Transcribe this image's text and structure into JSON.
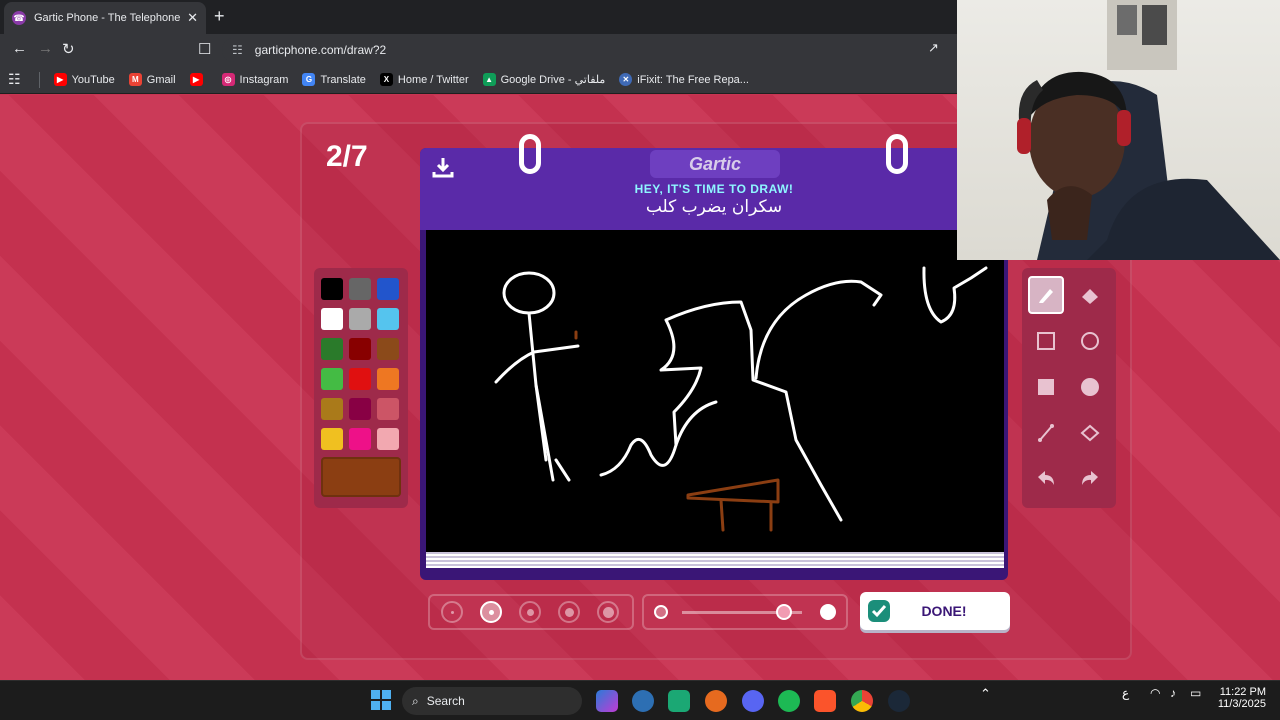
{
  "browser": {
    "tab_title": "Gartic Phone - The Telephone Game",
    "url": "garticphone.com/draw?2",
    "bookmarks": [
      {
        "label": "YouTube",
        "icon": "youtube-icon",
        "color": "#ff0000"
      },
      {
        "label": "Gmail",
        "icon": "gmail-icon",
        "color": "#ea4335"
      },
      {
        "label": "",
        "icon": "youtube-icon",
        "color": "#ff0000"
      },
      {
        "label": "Instagram",
        "icon": "instagram-icon",
        "color": "#d62976"
      },
      {
        "label": "Translate",
        "icon": "translate-icon",
        "color": "#4285f4"
      },
      {
        "label": "Home / Twitter",
        "icon": "x-icon",
        "color": "#000000"
      },
      {
        "label": "Google Drive - ملفاتي",
        "icon": "drive-icon",
        "color": "#0f9d58"
      },
      {
        "label": "iFixit: The Free Repa...",
        "icon": "ifixit-icon",
        "color": "#3f6ab6"
      }
    ]
  },
  "game": {
    "round": "2/7",
    "logo": "Gartic",
    "heading": "HEY, IT'S TIME TO DRAW!",
    "prompt": "سكران يضرب كلب",
    "done_label": "DONE!",
    "colors": [
      "#000000",
      "#666666",
      "#2255cc",
      "#ffffff",
      "#aaaaaa",
      "#55c4ee",
      "#2a7a2a",
      "#880000",
      "#8b4a1a",
      "#44bb44",
      "#e01010",
      "#ee7722",
      "#aa7a1a",
      "#880044",
      "#cc5566",
      "#f0c020",
      "#ee1188",
      "#f2a8b0"
    ],
    "selected_color": "#8b3e12",
    "brush_sizes": 5,
    "selected_size_index": 1,
    "opacity_percent": 85,
    "tools": [
      "pen-icon",
      "eraser-icon",
      "rectangle-outline-icon",
      "ellipse-outline-icon",
      "rectangle-fill-icon",
      "ellipse-fill-icon",
      "line-icon",
      "bucket-icon",
      "undo-icon",
      "redo-icon"
    ]
  },
  "taskbar": {
    "search_label": "Search",
    "time": "11:22 PM",
    "date": "11/3/2025",
    "lang": "ع"
  }
}
